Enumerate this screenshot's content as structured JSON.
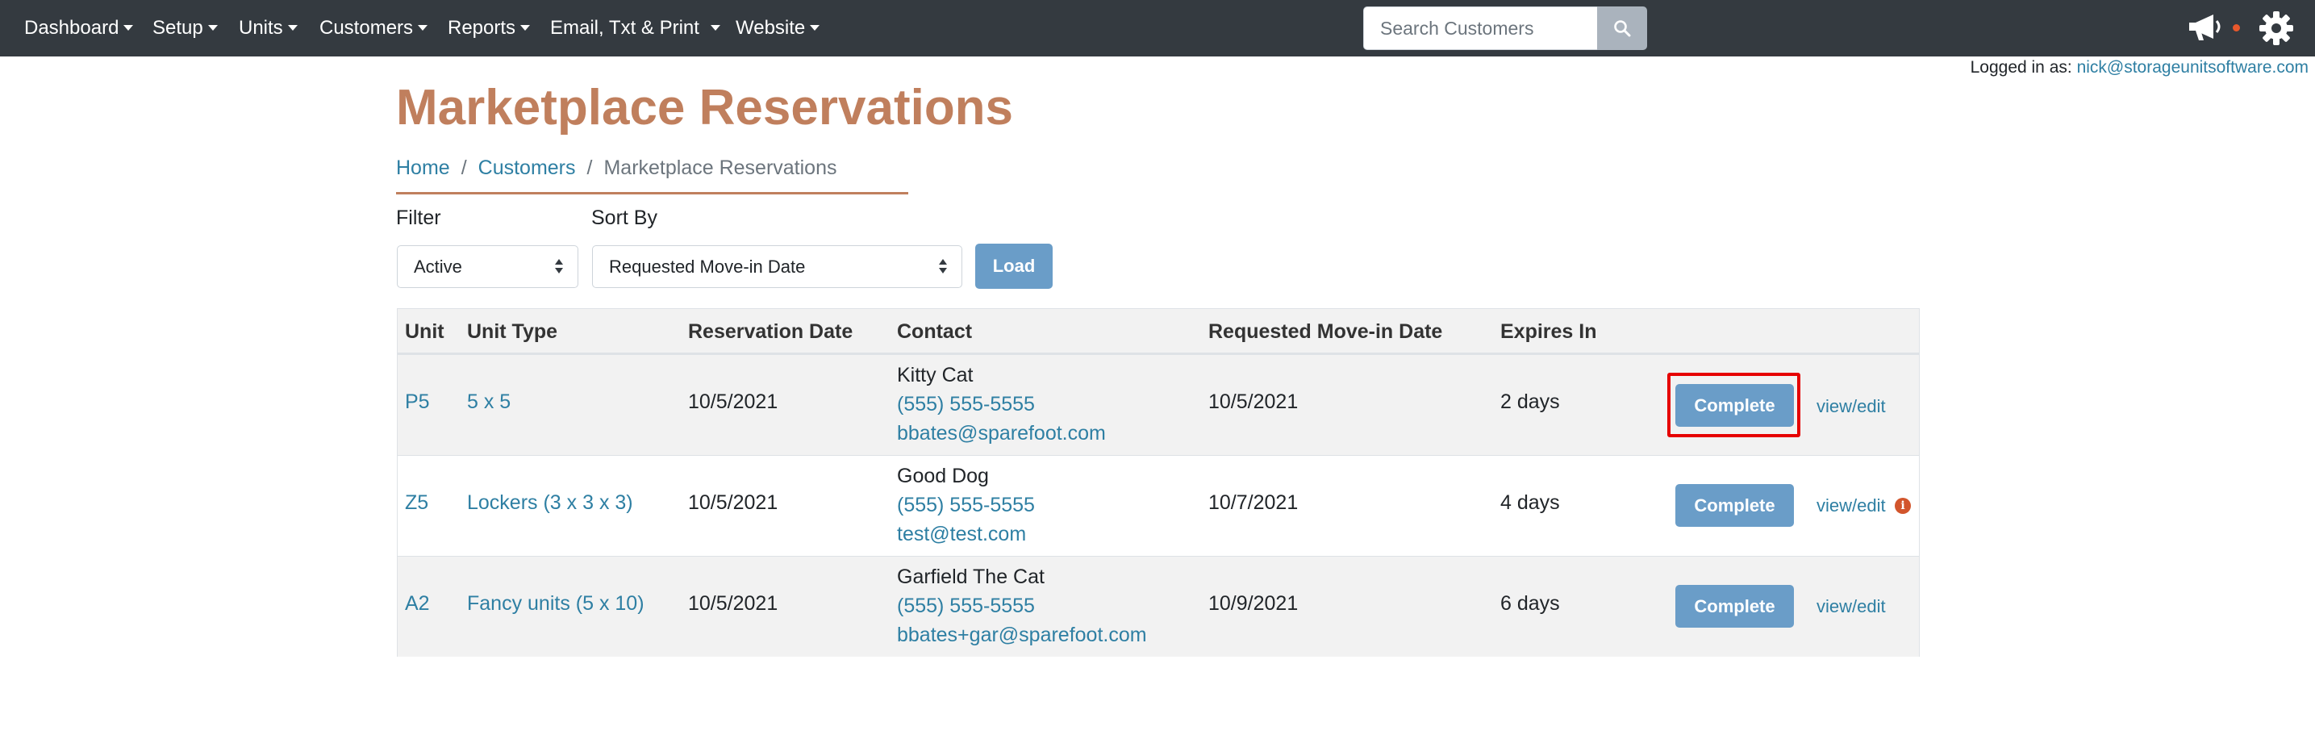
{
  "nav": {
    "items": [
      {
        "label": "Dashboard"
      },
      {
        "label": "Setup"
      },
      {
        "label": "Units"
      },
      {
        "label": "Customers"
      },
      {
        "label": "Reports"
      },
      {
        "label": "Email, Txt & Print"
      },
      {
        "label": "Website"
      }
    ],
    "search_placeholder": "Search Customers",
    "icons": [
      "search-icon",
      "megaphone-icon",
      "gear-icon"
    ]
  },
  "user": {
    "logged_in_label": "Logged in as:",
    "email": "nick@storageunitsoftware.com"
  },
  "page": {
    "title": "Marketplace Reservations",
    "breadcrumb": [
      "Home",
      "Customers",
      "Marketplace Reservations"
    ]
  },
  "filters": {
    "filter_label": "Filter",
    "filter_value": "Active",
    "sort_label": "Sort By",
    "sort_value": "Requested Move-in Date",
    "load_label": "Load"
  },
  "table": {
    "headers": [
      "Unit",
      "Unit Type",
      "Reservation Date",
      "Contact",
      "Requested Move-in Date",
      "Expires In"
    ],
    "rows": [
      {
        "unit": "P5",
        "unit_type": "5 x 5",
        "reservation_date": "10/5/2021",
        "contact_name": "Kitty Cat",
        "contact_phone": "(555) 555-5555",
        "contact_email": "bbates@sparefoot.com",
        "move_in_date": "10/5/2021",
        "expires_in": "2 days",
        "complete_label": "Complete",
        "view_edit_label": "view/edit",
        "highlighted": true,
        "has_info": false
      },
      {
        "unit": "Z5",
        "unit_type": "Lockers (3 x 3 x 3)",
        "reservation_date": "10/5/2021",
        "contact_name": "Good Dog",
        "contact_phone": "(555) 555-5555",
        "contact_email": "test@test.com",
        "move_in_date": "10/7/2021",
        "expires_in": "4 days",
        "complete_label": "Complete",
        "view_edit_label": "view/edit",
        "highlighted": false,
        "has_info": true
      },
      {
        "unit": "A2",
        "unit_type": "Fancy units (5 x 10)",
        "reservation_date": "10/5/2021",
        "contact_name": "Garfield The Cat",
        "contact_phone": "(555) 555-5555",
        "contact_email": "bbates+gar@sparefoot.com",
        "move_in_date": "10/9/2021",
        "expires_in": "6 days",
        "complete_label": "Complete",
        "view_edit_label": "view/edit",
        "highlighted": false,
        "has_info": false
      }
    ]
  },
  "colors": {
    "navbar": "#343a40",
    "title": "#c07f5d",
    "link": "#2e7fa3",
    "button": "#6a9dc8",
    "highlight": "#e60000",
    "info": "#d2552c"
  }
}
